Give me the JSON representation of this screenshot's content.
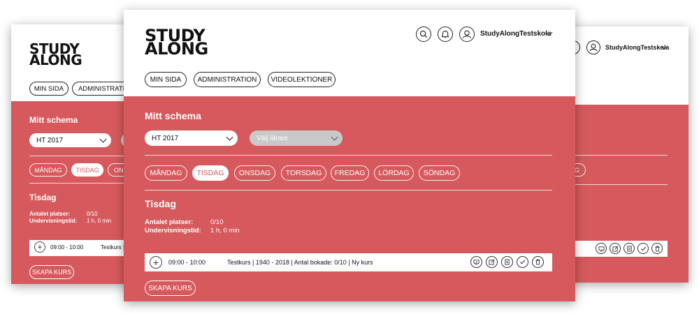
{
  "brand": {
    "logo_line1": "STUDY",
    "logo_line2": "ALONG"
  },
  "header": {
    "user_name": "StudyAlongTestskola"
  },
  "nav": {
    "items": [
      "MIN SIDA",
      "ADMINISTRATION",
      "VIDEOLEKTIONER"
    ],
    "left_items": [
      "MIN SIDA",
      "ADMINISTRATION"
    ]
  },
  "schedule": {
    "title": "Mitt schema",
    "term_select": "HT 2017",
    "teacher_select_placeholder": "Välj lärare",
    "days": [
      "MÅNDAG",
      "TISDAG",
      "ONSDAG",
      "TORSDAG",
      "FREDAG",
      "LÖRDAG",
      "SÖNDAG"
    ],
    "left_days": [
      "MÅNDAG",
      "TISDAG",
      "ONS"
    ],
    "right_days": [
      "DAG"
    ],
    "selected_day": "TISDAG",
    "day_heading": "Tisdag",
    "stats": [
      {
        "label": "Antalet platser:",
        "value": "0/10"
      },
      {
        "label": "Undervisningstid:",
        "value": "1 h, 0 min"
      }
    ],
    "course_row": {
      "time": "09:00 - 10:00",
      "description": "Testkurs | 1940 - 2018 | Antal bokade: 0/10 | Ny kurs",
      "left_description": "Testkurs |"
    },
    "create_button": "SKAPA KURS"
  },
  "colors": {
    "accent": "#d65a5d",
    "card": "#ffffff",
    "ink": "#111111"
  }
}
